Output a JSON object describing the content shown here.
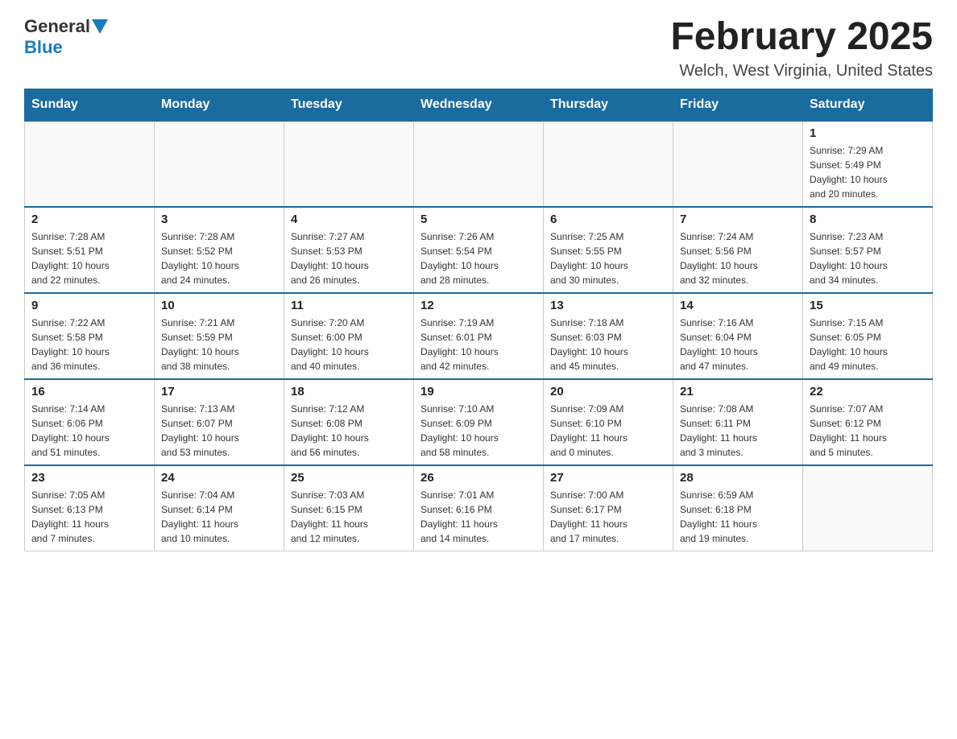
{
  "header": {
    "logo": {
      "general": "General",
      "blue": "Blue"
    },
    "title": "February 2025",
    "location": "Welch, West Virginia, United States"
  },
  "days_of_week": [
    "Sunday",
    "Monday",
    "Tuesday",
    "Wednesday",
    "Thursday",
    "Friday",
    "Saturday"
  ],
  "weeks": [
    [
      {
        "day": "",
        "info": ""
      },
      {
        "day": "",
        "info": ""
      },
      {
        "day": "",
        "info": ""
      },
      {
        "day": "",
        "info": ""
      },
      {
        "day": "",
        "info": ""
      },
      {
        "day": "",
        "info": ""
      },
      {
        "day": "1",
        "info": "Sunrise: 7:29 AM\nSunset: 5:49 PM\nDaylight: 10 hours\nand 20 minutes."
      }
    ],
    [
      {
        "day": "2",
        "info": "Sunrise: 7:28 AM\nSunset: 5:51 PM\nDaylight: 10 hours\nand 22 minutes."
      },
      {
        "day": "3",
        "info": "Sunrise: 7:28 AM\nSunset: 5:52 PM\nDaylight: 10 hours\nand 24 minutes."
      },
      {
        "day": "4",
        "info": "Sunrise: 7:27 AM\nSunset: 5:53 PM\nDaylight: 10 hours\nand 26 minutes."
      },
      {
        "day": "5",
        "info": "Sunrise: 7:26 AM\nSunset: 5:54 PM\nDaylight: 10 hours\nand 28 minutes."
      },
      {
        "day": "6",
        "info": "Sunrise: 7:25 AM\nSunset: 5:55 PM\nDaylight: 10 hours\nand 30 minutes."
      },
      {
        "day": "7",
        "info": "Sunrise: 7:24 AM\nSunset: 5:56 PM\nDaylight: 10 hours\nand 32 minutes."
      },
      {
        "day": "8",
        "info": "Sunrise: 7:23 AM\nSunset: 5:57 PM\nDaylight: 10 hours\nand 34 minutes."
      }
    ],
    [
      {
        "day": "9",
        "info": "Sunrise: 7:22 AM\nSunset: 5:58 PM\nDaylight: 10 hours\nand 36 minutes."
      },
      {
        "day": "10",
        "info": "Sunrise: 7:21 AM\nSunset: 5:59 PM\nDaylight: 10 hours\nand 38 minutes."
      },
      {
        "day": "11",
        "info": "Sunrise: 7:20 AM\nSunset: 6:00 PM\nDaylight: 10 hours\nand 40 minutes."
      },
      {
        "day": "12",
        "info": "Sunrise: 7:19 AM\nSunset: 6:01 PM\nDaylight: 10 hours\nand 42 minutes."
      },
      {
        "day": "13",
        "info": "Sunrise: 7:18 AM\nSunset: 6:03 PM\nDaylight: 10 hours\nand 45 minutes."
      },
      {
        "day": "14",
        "info": "Sunrise: 7:16 AM\nSunset: 6:04 PM\nDaylight: 10 hours\nand 47 minutes."
      },
      {
        "day": "15",
        "info": "Sunrise: 7:15 AM\nSunset: 6:05 PM\nDaylight: 10 hours\nand 49 minutes."
      }
    ],
    [
      {
        "day": "16",
        "info": "Sunrise: 7:14 AM\nSunset: 6:06 PM\nDaylight: 10 hours\nand 51 minutes."
      },
      {
        "day": "17",
        "info": "Sunrise: 7:13 AM\nSunset: 6:07 PM\nDaylight: 10 hours\nand 53 minutes."
      },
      {
        "day": "18",
        "info": "Sunrise: 7:12 AM\nSunset: 6:08 PM\nDaylight: 10 hours\nand 56 minutes."
      },
      {
        "day": "19",
        "info": "Sunrise: 7:10 AM\nSunset: 6:09 PM\nDaylight: 10 hours\nand 58 minutes."
      },
      {
        "day": "20",
        "info": "Sunrise: 7:09 AM\nSunset: 6:10 PM\nDaylight: 11 hours\nand 0 minutes."
      },
      {
        "day": "21",
        "info": "Sunrise: 7:08 AM\nSunset: 6:11 PM\nDaylight: 11 hours\nand 3 minutes."
      },
      {
        "day": "22",
        "info": "Sunrise: 7:07 AM\nSunset: 6:12 PM\nDaylight: 11 hours\nand 5 minutes."
      }
    ],
    [
      {
        "day": "23",
        "info": "Sunrise: 7:05 AM\nSunset: 6:13 PM\nDaylight: 11 hours\nand 7 minutes."
      },
      {
        "day": "24",
        "info": "Sunrise: 7:04 AM\nSunset: 6:14 PM\nDaylight: 11 hours\nand 10 minutes."
      },
      {
        "day": "25",
        "info": "Sunrise: 7:03 AM\nSunset: 6:15 PM\nDaylight: 11 hours\nand 12 minutes."
      },
      {
        "day": "26",
        "info": "Sunrise: 7:01 AM\nSunset: 6:16 PM\nDaylight: 11 hours\nand 14 minutes."
      },
      {
        "day": "27",
        "info": "Sunrise: 7:00 AM\nSunset: 6:17 PM\nDaylight: 11 hours\nand 17 minutes."
      },
      {
        "day": "28",
        "info": "Sunrise: 6:59 AM\nSunset: 6:18 PM\nDaylight: 11 hours\nand 19 minutes."
      },
      {
        "day": "",
        "info": ""
      }
    ]
  ]
}
